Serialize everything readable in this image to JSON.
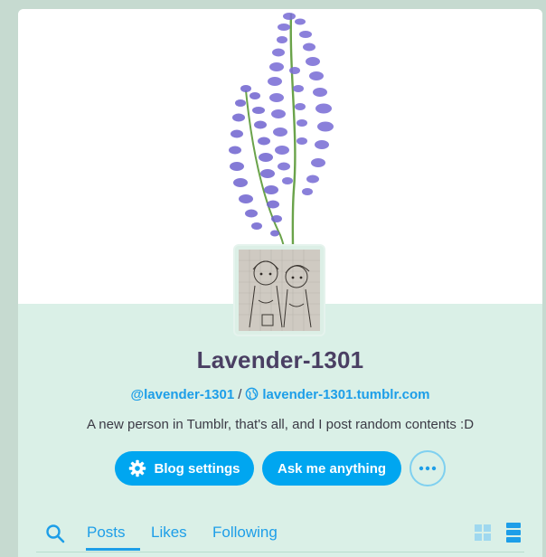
{
  "blog": {
    "title": "Lavender-1301",
    "handle": "@lavender-1301",
    "separator": "/",
    "url": "lavender-1301.tumblr.com",
    "description": "A new person in Tumblr, that's all, and I post random contents :D"
  },
  "actions": {
    "settings_label": "Blog settings",
    "ask_label": "Ask me anything",
    "more_icon": "ellipsis-icon"
  },
  "tabs": {
    "search_icon": "search-icon",
    "items": [
      {
        "label": "Posts",
        "active": true
      },
      {
        "label": "Likes",
        "active": false
      },
      {
        "label": "Following",
        "active": false
      }
    ]
  },
  "view_toggle": {
    "grid_icon": "grid-view-icon",
    "list_icon": "list-view-icon",
    "selected": "list"
  },
  "colors": {
    "accent": "#1d9ee8",
    "button": "#00a6f0",
    "title": "#4a3f63",
    "background": "#daf0e7",
    "page_background": "#c6dad0",
    "lavender": "#7b6fd6"
  }
}
